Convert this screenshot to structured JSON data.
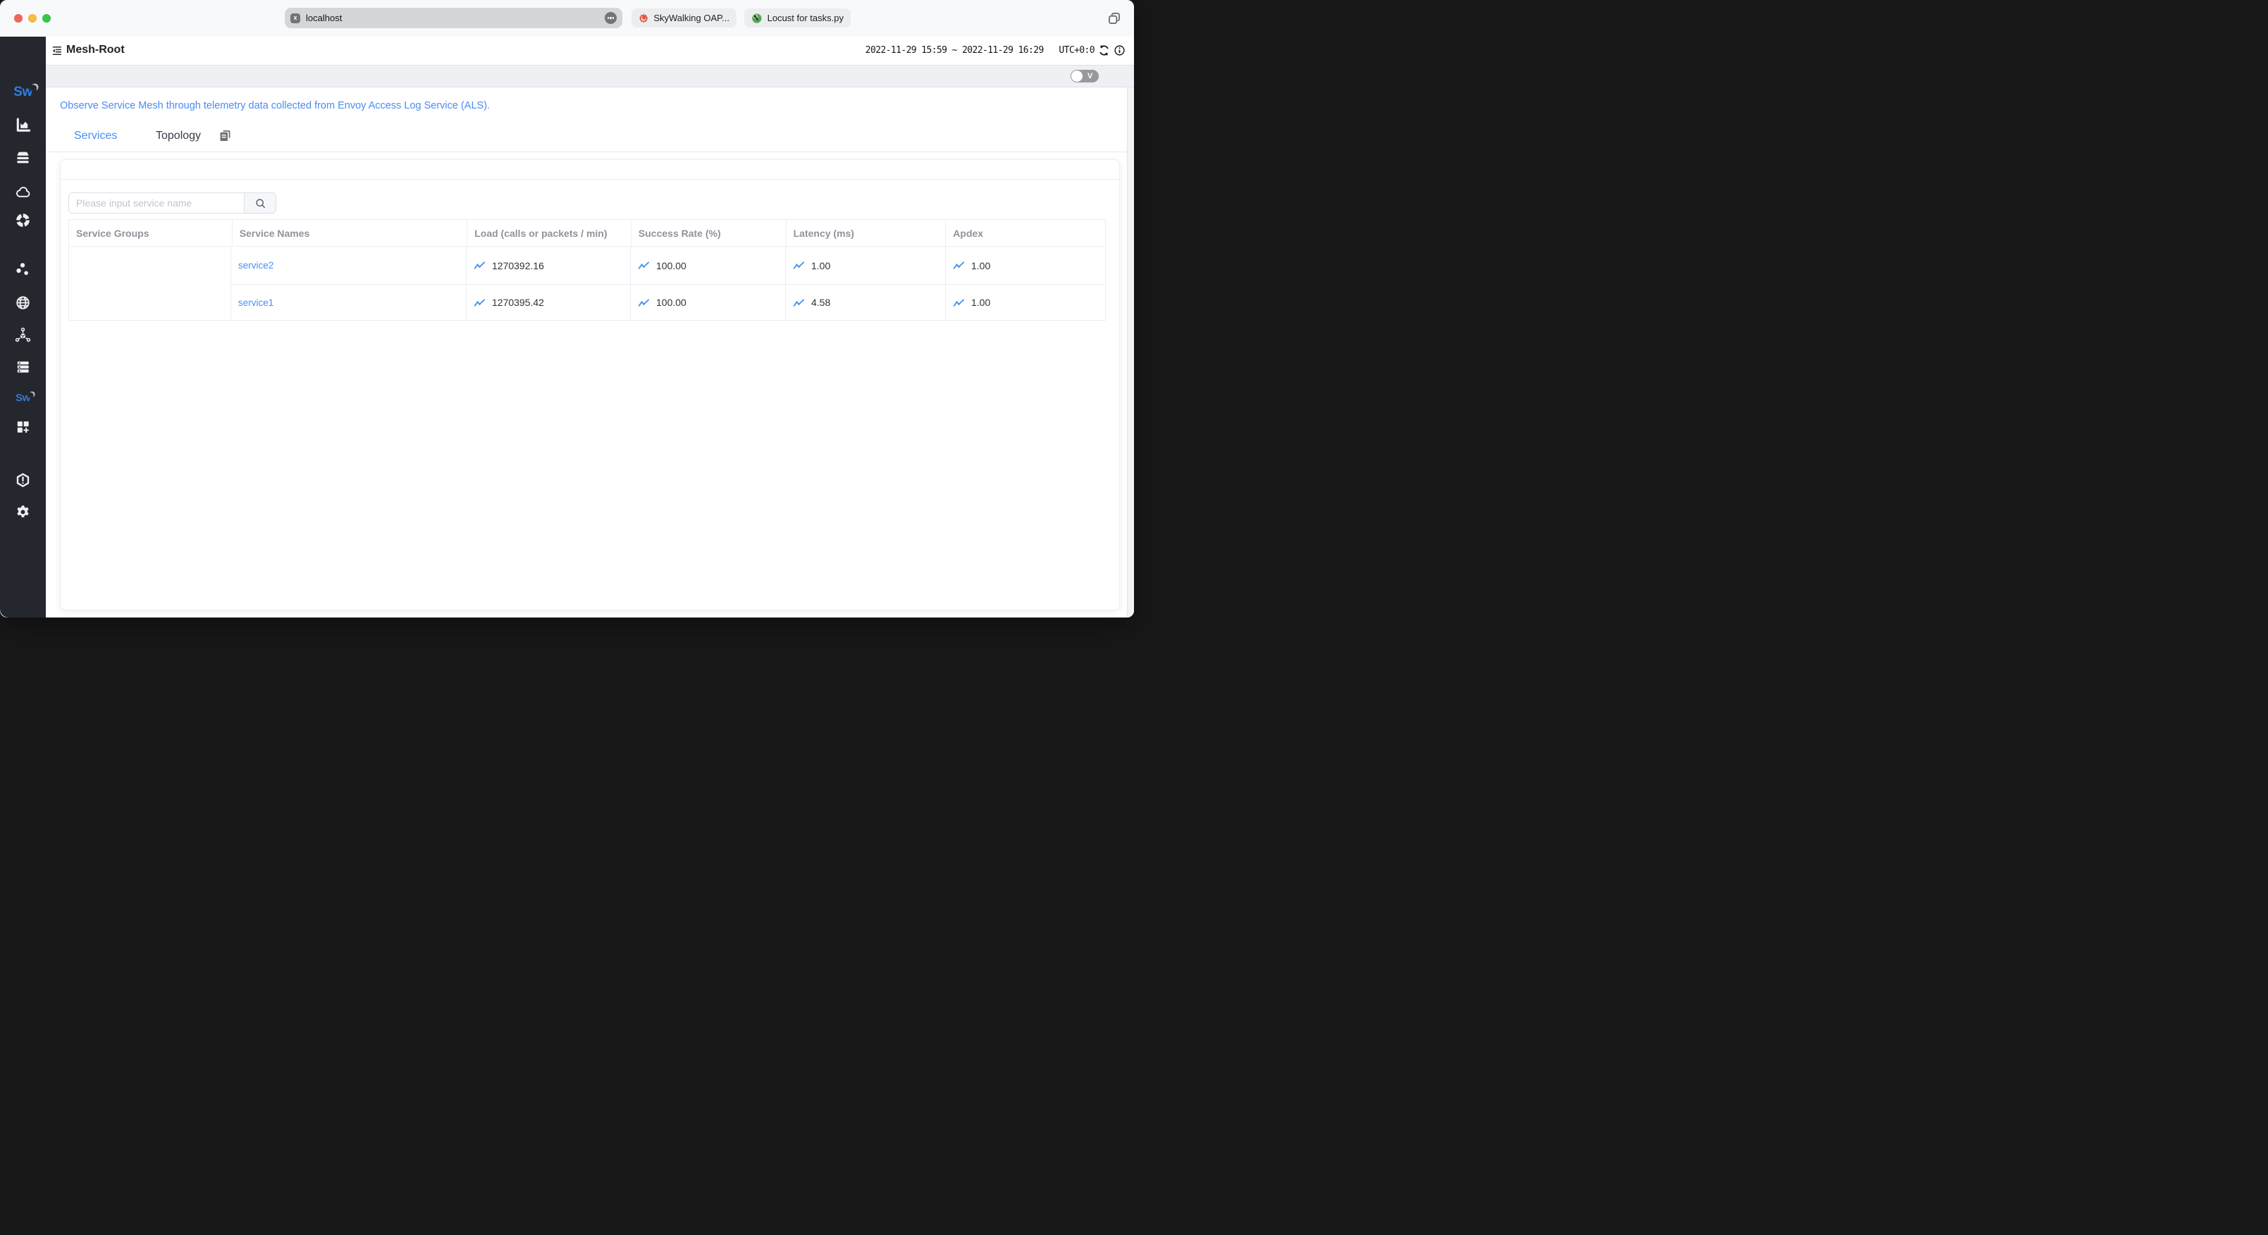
{
  "browser": {
    "url": "localhost",
    "url_badge": "x",
    "pinned_tabs": [
      {
        "label": "SkyWalking OAP..."
      },
      {
        "label": "Locust for tasks.py"
      }
    ]
  },
  "sidebar": {
    "logo_text": "Sw",
    "mini_logo_text": "Sw",
    "icons": [
      "skywalking-logo",
      "bar-chart",
      "database",
      "cloud",
      "donut-chart",
      "scatter-dots",
      "globe",
      "service-mesh",
      "server-list",
      "skywalking-mini-logo",
      "dashboard-grid-plus",
      "alert-hexagon",
      "settings-gear"
    ]
  },
  "header": {
    "title": "Mesh-Root",
    "time_range": "2022-11-29 15:59 ~ 2022-11-29 16:29",
    "timezone": "UTC+0:0"
  },
  "toolbar": {
    "version_toggle_label": "V"
  },
  "page": {
    "description": "Observe Service Mesh through telemetry data collected from Envoy Access Log Service (ALS).",
    "tabs": [
      {
        "label": "Services"
      },
      {
        "label": "Topology"
      }
    ]
  },
  "search": {
    "placeholder": "Please input service name"
  },
  "table": {
    "columns": [
      "Service Groups",
      "Service Names",
      "Load (calls or packets / min)",
      "Success Rate (%)",
      "Latency (ms)",
      "Apdex"
    ],
    "rows": [
      {
        "group": "",
        "name": "service2",
        "load": "1270392.16",
        "success_rate": "100.00",
        "latency": "1.00",
        "apdex": "1.00"
      },
      {
        "group": "",
        "name": "service1",
        "load": "1270395.42",
        "success_rate": "100.00",
        "latency": "4.58",
        "apdex": "1.00"
      }
    ]
  },
  "colors": {
    "accent_blue": "#478ff5",
    "sidebar_bg": "#24272e",
    "toolbar_gray": "#eef0f3"
  }
}
